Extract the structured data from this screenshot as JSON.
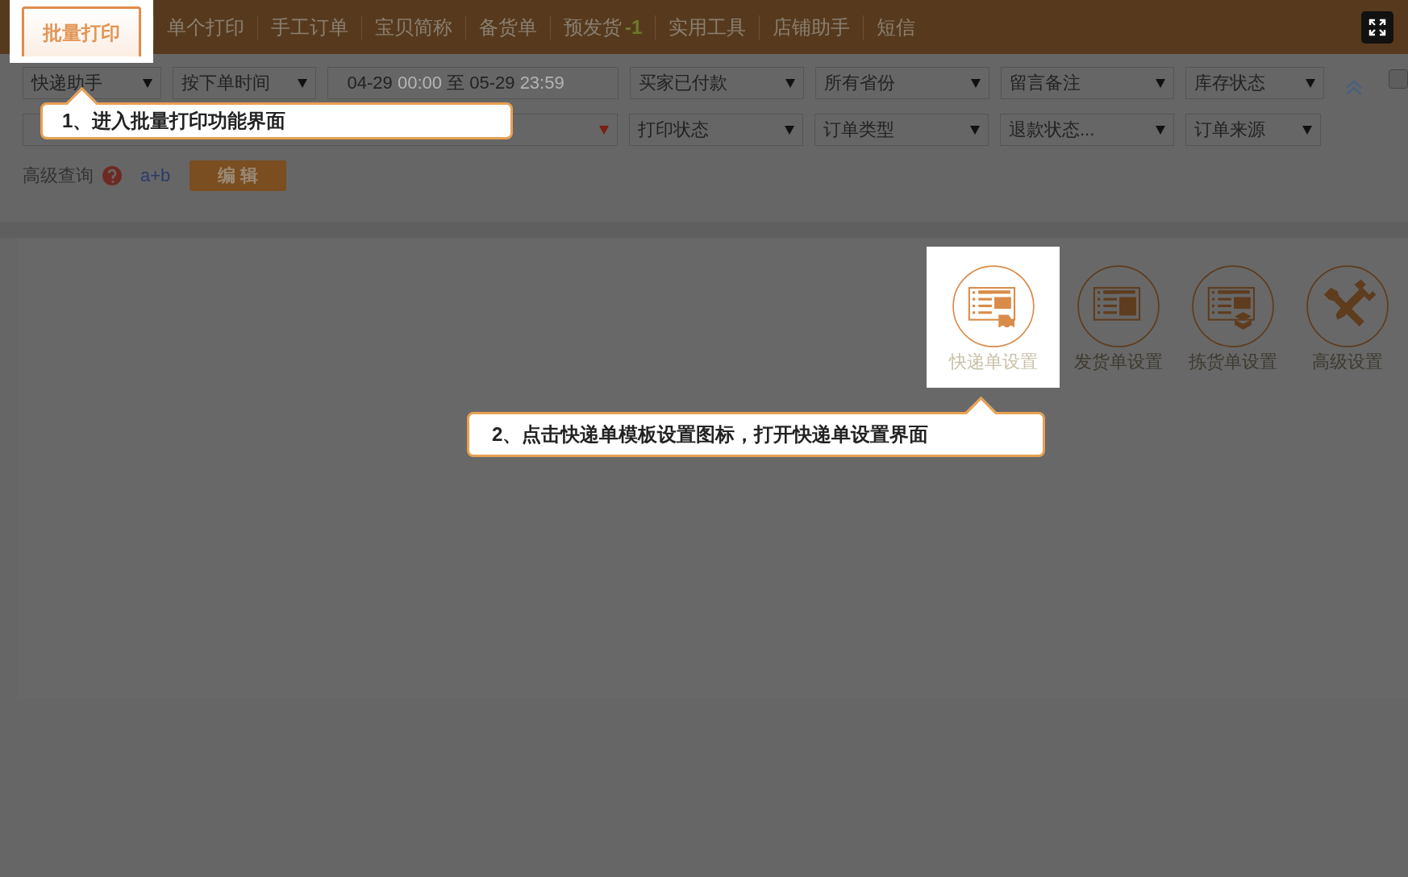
{
  "tabs": [
    {
      "label": "批量打印",
      "selected": true
    },
    {
      "label": "单个打印",
      "selected": false
    },
    {
      "label": "手工订单",
      "selected": false
    },
    {
      "label": "宝贝简称",
      "selected": false
    },
    {
      "label": "备货单",
      "selected": false
    },
    {
      "label": "预发货",
      "badge": "-1",
      "selected": false
    },
    {
      "label": "实用工具",
      "selected": false
    },
    {
      "label": "店铺助手",
      "selected": false
    },
    {
      "label": "短信",
      "selected": false
    }
  ],
  "filters_row1": [
    {
      "kind": "select",
      "value": "快递助手"
    },
    {
      "kind": "select",
      "value": "按下单时间"
    },
    {
      "kind": "date_range",
      "start_date": "04-29",
      "start_time": "00:00",
      "separator": "至",
      "end_date": "05-29",
      "end_time": "23:59"
    },
    {
      "kind": "select",
      "value": "买家已付款"
    },
    {
      "kind": "select",
      "value": "所有省份"
    },
    {
      "kind": "select",
      "value": "留言备注"
    },
    {
      "kind": "select",
      "value": "库存状态"
    }
  ],
  "filters_row2": [
    {
      "kind": "wide_select"
    },
    {
      "kind": "select",
      "value": "打印状态"
    },
    {
      "kind": "select",
      "value": "订单类型"
    },
    {
      "kind": "select",
      "value": "退款状态..."
    },
    {
      "kind": "select",
      "value": "订单来源"
    }
  ],
  "advanced_query": {
    "label": "高级查询",
    "example": "a+b",
    "edit_button": "编 辑"
  },
  "checkbox": {
    "checked": false
  },
  "settings": [
    {
      "label": "快递单设置",
      "kind": "waybill",
      "selected": true
    },
    {
      "label": "发货单设置",
      "kind": "invoice",
      "selected": false
    },
    {
      "label": "拣货单设置",
      "kind": "picking",
      "selected": false
    },
    {
      "label": "高级设置",
      "kind": "tools",
      "selected": false
    }
  ],
  "callouts": [
    {
      "text": "1、进入批量打印功能界面"
    },
    {
      "text": "2、点击快递单模板设置图标，打开快递单设置界面"
    }
  ]
}
